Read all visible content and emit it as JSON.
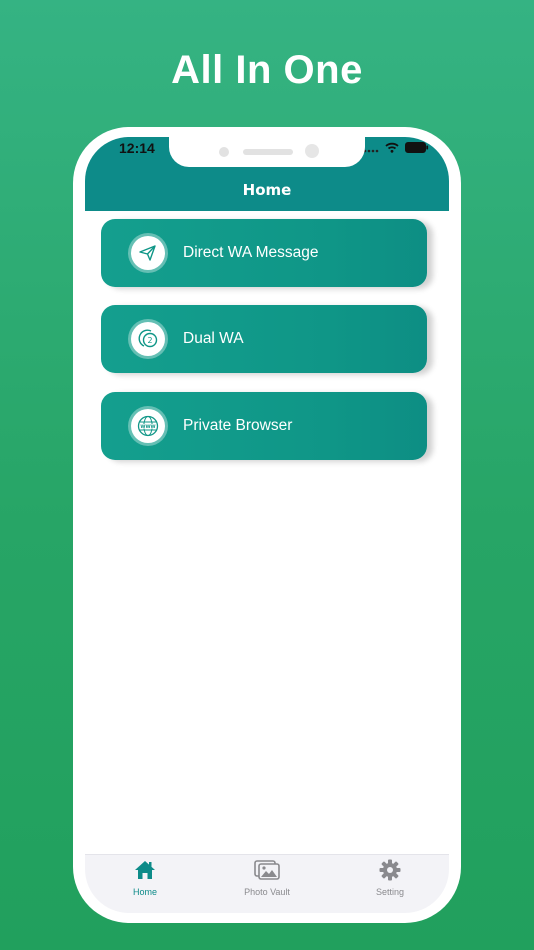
{
  "promo": {
    "headline": "All In One"
  },
  "status_bar": {
    "time": "12:14"
  },
  "nav": {
    "title": "Home"
  },
  "menu": [
    {
      "label": "Direct WA Message",
      "icon": "paper-plane-icon"
    },
    {
      "label": "Dual WA",
      "icon": "dual-chat-icon"
    },
    {
      "label": "Private Browser",
      "icon": "globe-www-icon"
    }
  ],
  "tabs": [
    {
      "label": "Home",
      "icon": "home-icon",
      "active": true
    },
    {
      "label": "Photo Vault",
      "icon": "photo-gallery-icon",
      "active": false
    },
    {
      "label": "Setting",
      "icon": "gear-icon",
      "active": false
    }
  ],
  "colors": {
    "background": "#2aaa6c",
    "header": "#0d8b89",
    "card": "#129a8b",
    "active_tab": "#0d8b89",
    "inactive_tab": "#8a8a8e"
  }
}
